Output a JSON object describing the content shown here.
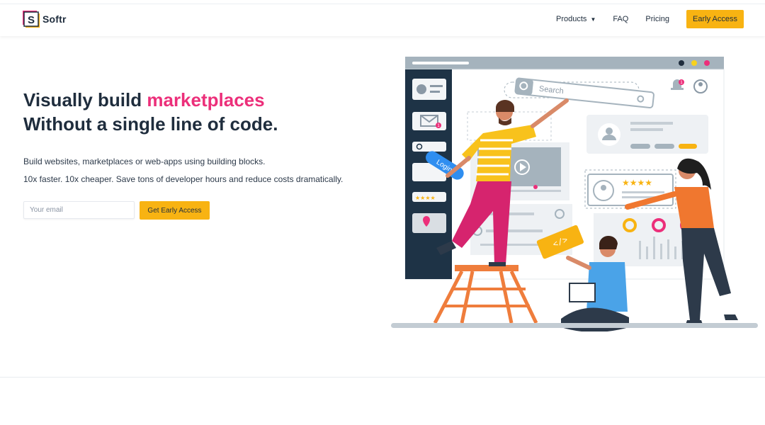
{
  "brand": {
    "name": "Softr",
    "logo_letter": "S"
  },
  "nav": {
    "items": [
      "Products",
      "FAQ",
      "Pricing"
    ],
    "cta": "Early Access"
  },
  "hero": {
    "title_plain": "Visually build ",
    "title_accent": "marketplaces",
    "subtitle": "Without a single line of code.",
    "desc1": "Build websites, marketplaces or web-apps using building blocks.",
    "desc2": "10x faster. 10x cheaper. Save tons of developer hours and reduce costs dramatically.",
    "email_placeholder": "Your email",
    "cta": "Get Early Access"
  },
  "illustration": {
    "search_label": "Search",
    "login_label": "Login",
    "code_label": "</>",
    "notification_count": "1",
    "mail_count": "1"
  },
  "colors": {
    "accent_pink": "#ec2f7a",
    "cta_yellow": "#f8b312",
    "text_dark": "#1f2d3d"
  }
}
